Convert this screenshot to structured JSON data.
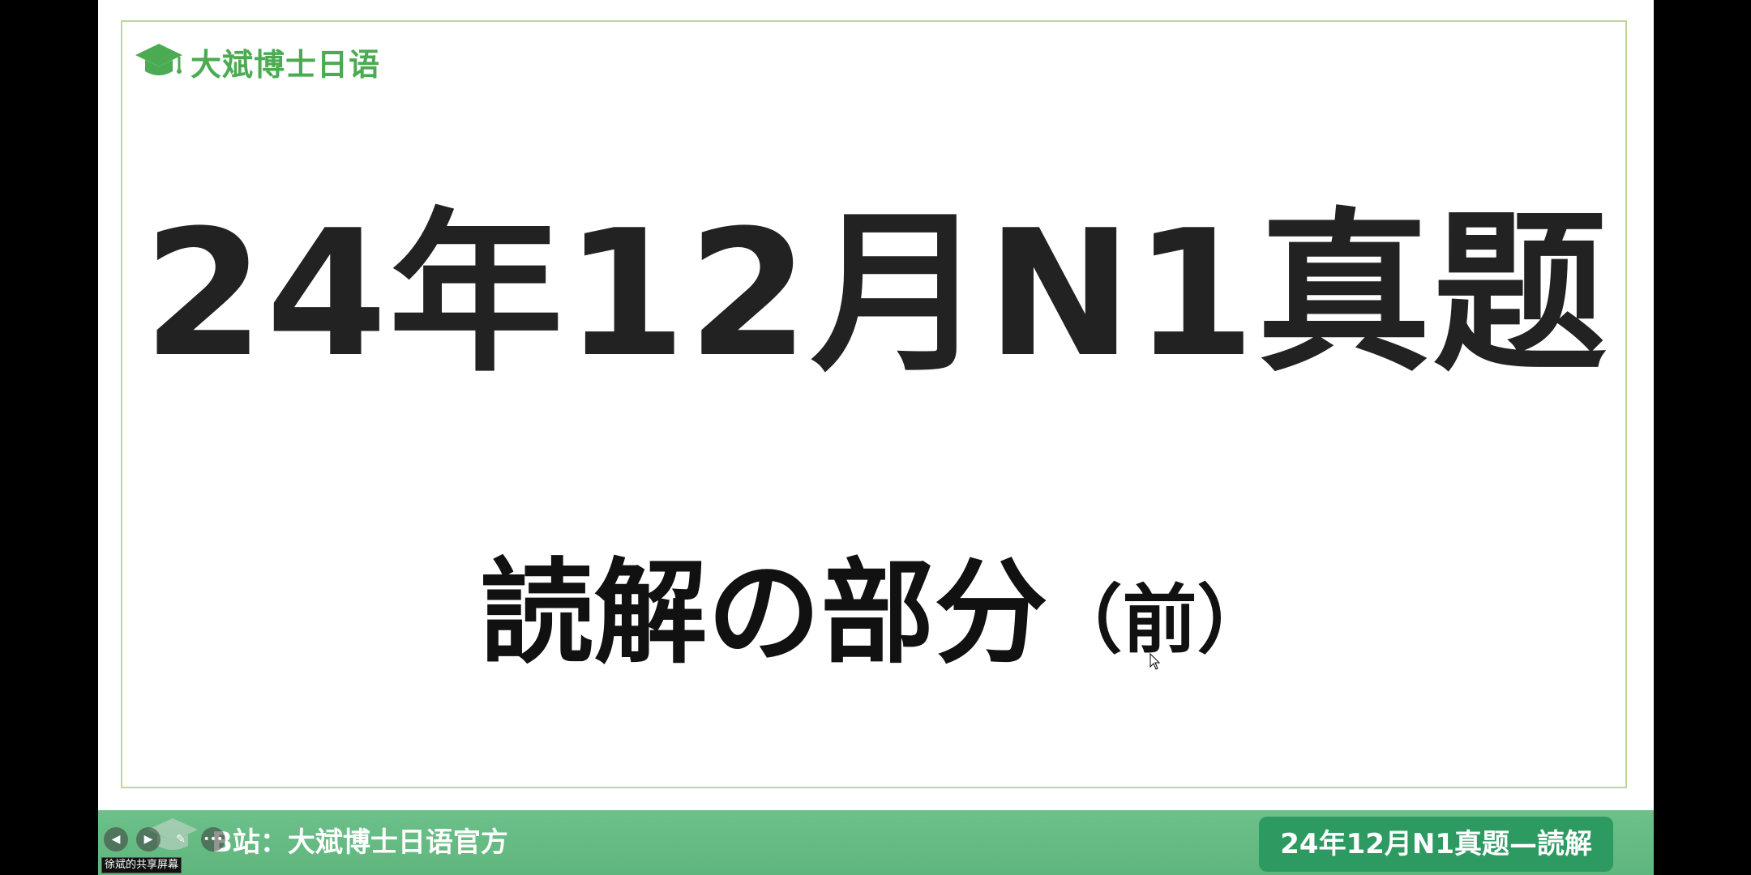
{
  "slide": {
    "logo_text": "大斌博士日语",
    "title": "24年12月N1真题",
    "subtitle_main": "読解の部分",
    "subtitle_paren": "（前）"
  },
  "bottom_bar": {
    "channel_label": "B站：大斌博士日语官方",
    "series_badge": "24年12月N1真题—読解"
  },
  "overlay": {
    "share_label": "徐斌的共享屏幕"
  },
  "colors": {
    "brand_green": "#4bab52",
    "bar_green": "#6cc08a",
    "badge_green": "#2d9a62",
    "frame_green": "#bcd79a",
    "title_text": "#222222"
  },
  "icons": {
    "logo": "graduation-cap-icon",
    "prev": "prev-slide-icon",
    "next": "next-slide-icon",
    "pen": "pen-icon",
    "more": "more-icon"
  }
}
